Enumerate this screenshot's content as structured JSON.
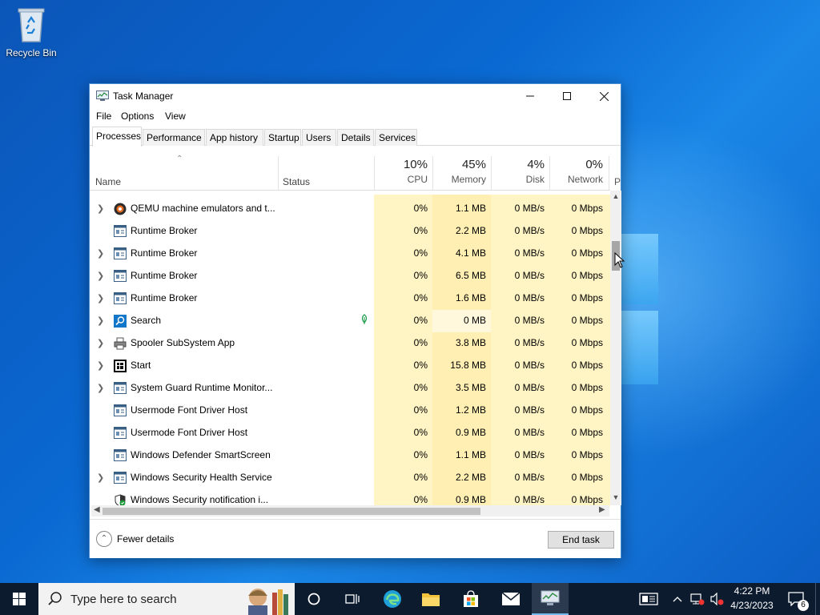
{
  "desktop": {
    "recycle_bin_label": "Recycle Bin"
  },
  "window": {
    "title": "Task Manager",
    "menu": [
      "File",
      "Options",
      "View"
    ],
    "tabs": [
      "Processes",
      "Performance",
      "App history",
      "Startup",
      "Users",
      "Details",
      "Services"
    ],
    "active_tab": "Processes"
  },
  "columns": {
    "name": "Name",
    "status": "Status",
    "cpu": {
      "pct": "10%",
      "label": "CPU"
    },
    "memory": {
      "pct": "45%",
      "label": "Memory"
    },
    "disk": {
      "pct": "4%",
      "label": "Disk"
    },
    "network": {
      "pct": "0%",
      "label": "Network"
    },
    "power_truncated": "P"
  },
  "processes": [
    {
      "name": "QEMU machine emulators and t...",
      "expandable": true,
      "icon": "qemu-icon",
      "cpu": "0%",
      "memory": "1.1 MB",
      "disk": "0 MB/s",
      "network": "0 Mbps"
    },
    {
      "name": "Runtime Broker",
      "expandable": false,
      "icon": "app-window-icon",
      "cpu": "0%",
      "memory": "2.2 MB",
      "disk": "0 MB/s",
      "network": "0 Mbps"
    },
    {
      "name": "Runtime Broker",
      "expandable": true,
      "icon": "app-window-icon",
      "cpu": "0%",
      "memory": "4.1 MB",
      "disk": "0 MB/s",
      "network": "0 Mbps"
    },
    {
      "name": "Runtime Broker",
      "expandable": true,
      "icon": "app-window-icon",
      "cpu": "0%",
      "memory": "6.5 MB",
      "disk": "0 MB/s",
      "network": "0 Mbps"
    },
    {
      "name": "Runtime Broker",
      "expandable": true,
      "icon": "app-window-icon",
      "cpu": "0%",
      "memory": "1.6 MB",
      "disk": "0 MB/s",
      "network": "0 Mbps"
    },
    {
      "name": "Search",
      "expandable": true,
      "icon": "search-app-icon",
      "suspended_leaf": true,
      "cpu": "0%",
      "memory": "0 MB",
      "disk": "0 MB/s",
      "network": "0 Mbps"
    },
    {
      "name": "Spooler SubSystem App",
      "expandable": true,
      "icon": "printer-icon",
      "cpu": "0%",
      "memory": "3.8 MB",
      "disk": "0 MB/s",
      "network": "0 Mbps"
    },
    {
      "name": "Start",
      "expandable": true,
      "icon": "start-app-icon",
      "cpu": "0%",
      "memory": "15.8 MB",
      "disk": "0 MB/s",
      "network": "0 Mbps"
    },
    {
      "name": "System Guard Runtime Monitor...",
      "expandable": true,
      "icon": "app-window-icon",
      "cpu": "0%",
      "memory": "3.5 MB",
      "disk": "0 MB/s",
      "network": "0 Mbps"
    },
    {
      "name": "Usermode Font Driver Host",
      "expandable": false,
      "icon": "app-window-icon",
      "cpu": "0%",
      "memory": "1.2 MB",
      "disk": "0 MB/s",
      "network": "0 Mbps"
    },
    {
      "name": "Usermode Font Driver Host",
      "expandable": false,
      "icon": "app-window-icon",
      "cpu": "0%",
      "memory": "0.9 MB",
      "disk": "0 MB/s",
      "network": "0 Mbps"
    },
    {
      "name": "Windows Defender SmartScreen",
      "expandable": false,
      "icon": "app-window-icon",
      "cpu": "0%",
      "memory": "1.1 MB",
      "disk": "0 MB/s",
      "network": "0 Mbps"
    },
    {
      "name": "Windows Security Health Service",
      "expandable": true,
      "icon": "app-window-icon",
      "cpu": "0%",
      "memory": "2.2 MB",
      "disk": "0 MB/s",
      "network": "0 Mbps"
    },
    {
      "name": "Windows Security notification i...",
      "expandable": false,
      "icon": "shield-icon",
      "cpu": "0%",
      "memory": "0.9 MB",
      "disk": "0 MB/s",
      "network": "0 Mbps"
    }
  ],
  "footer": {
    "fewer_details": "Fewer details",
    "end_task": "End task"
  },
  "taskbar": {
    "search_placeholder": "Type here to search",
    "time": "4:22 PM",
    "date": "4/23/2023",
    "notification_count": "6"
  },
  "colors": {
    "cpu_col": "#fff4c4",
    "mem_col": "#ffefb3",
    "accent": "#0078d7",
    "taskbar": "#0d1b2f"
  }
}
